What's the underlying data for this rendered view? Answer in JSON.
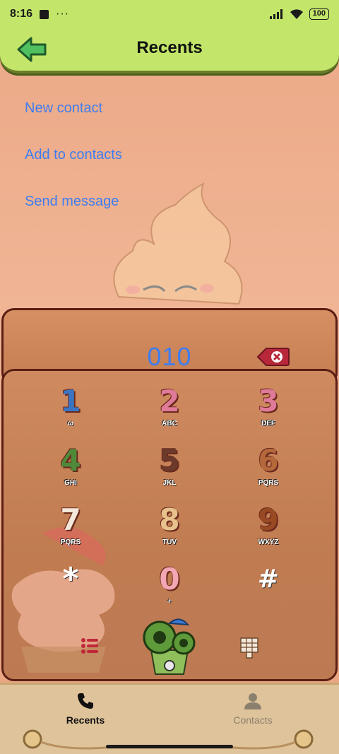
{
  "status": {
    "time": "8:16",
    "dots": "···",
    "battery": "100"
  },
  "appbar": {
    "title": "Recents",
    "back_icon": "arrow-left-icon",
    "color": "#c3e66a"
  },
  "actions": [
    {
      "label": "New contact"
    },
    {
      "label": "Add to contacts"
    },
    {
      "label": "Send message"
    }
  ],
  "dialer": {
    "number": "010",
    "keys": [
      {
        "digit": "1",
        "letters": "ω"
      },
      {
        "digit": "2",
        "letters": "ABC"
      },
      {
        "digit": "3",
        "letters": "DEF"
      },
      {
        "digit": "4",
        "letters": "GHI"
      },
      {
        "digit": "5",
        "letters": "JKL"
      },
      {
        "digit": "6",
        "letters": "PQRS"
      },
      {
        "digit": "7",
        "letters": "PQRS"
      },
      {
        "digit": "8",
        "letters": "TUV"
      },
      {
        "digit": "9",
        "letters": "WXYZ"
      },
      {
        "digit": "*",
        "letters": ""
      },
      {
        "digit": "0",
        "letters": "+"
      },
      {
        "digit": "#",
        "letters": ""
      }
    ]
  },
  "bottom_nav": {
    "items": [
      {
        "label": "Recents",
        "icon": "phone-icon",
        "active": true
      },
      {
        "label": "Contacts",
        "icon": "person-icon",
        "active": false
      }
    ]
  },
  "colors": {
    "accent": "#3f7df0",
    "panel_border": "#5a1e14",
    "nav_bg": "#dfc39a"
  }
}
